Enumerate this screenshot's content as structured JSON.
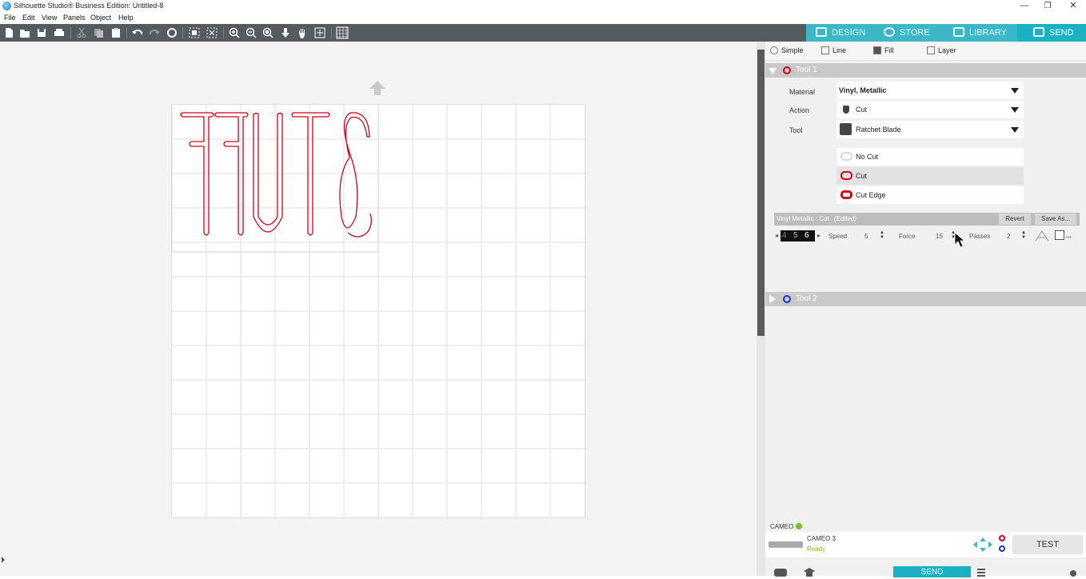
{
  "window": {
    "title": "Silhouette Studio® Business Edition: Untitled-8",
    "minimize": "—",
    "restore": "❐",
    "close": "✕"
  },
  "menu": [
    "File",
    "Edit",
    "View",
    "Panels",
    "Object",
    "Help"
  ],
  "topnav": [
    {
      "label": "DESIGN",
      "active": false
    },
    {
      "label": "STORE",
      "active": false
    },
    {
      "label": "LIBRARY",
      "active": false
    },
    {
      "label": "SEND",
      "active": true
    }
  ],
  "canvas": {
    "design_text": "STUFF",
    "design_mirrored": true,
    "design_color": "#d0021b"
  },
  "panel": {
    "tabs": [
      "Simple",
      "Line",
      "Fill",
      "Layer"
    ],
    "tool1": {
      "label": "Tool 1",
      "ring_color": "#d0021b",
      "material_label": "Material",
      "material_value": "Vinyl, Metallic",
      "action_label": "Action",
      "action_value": "Cut",
      "tool_label": "Tool",
      "tool_value": "Ratchet Blade",
      "action_options": [
        "No Cut",
        "Cut",
        "Cut Edge"
      ],
      "selected_action": "Cut",
      "settings_title": "Vinyl Metallic : Cut",
      "settings_edited": "(Edited)",
      "revert": "Revert",
      "save_as": "Save As...",
      "blade_digits": [
        "4",
        "5",
        "6"
      ],
      "speed_label": "Speed",
      "speed_value": "5",
      "force_label": "Force",
      "force_value": "15",
      "passes_label": "Passes",
      "passes_value": "2"
    },
    "tool2": {
      "label": "Tool 2",
      "ring_color": "#1a2fd6"
    },
    "device": {
      "section_label": "CAMEO",
      "name": "CAMEO 3",
      "status": "Ready",
      "test_label": "TEST",
      "send_label": "SEND"
    }
  }
}
